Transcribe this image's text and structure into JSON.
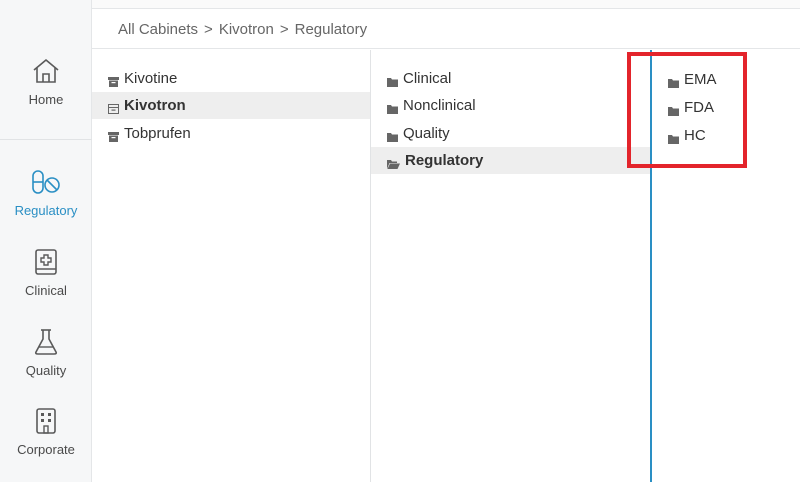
{
  "nav": {
    "items": [
      {
        "label": "Home",
        "icon": "home-icon"
      },
      {
        "label": "Regulatory",
        "icon": "capsule-pill-icon",
        "active": true
      },
      {
        "label": "Clinical",
        "icon": "medical-book-icon"
      },
      {
        "label": "Quality",
        "icon": "flask-icon"
      },
      {
        "label": "Corporate",
        "icon": "building-icon"
      }
    ],
    "accent_color": "#2a8fc4"
  },
  "breadcrumb": {
    "items": [
      "All Cabinets",
      "Kivotron",
      "Regulatory"
    ],
    "separator": ">"
  },
  "columns": {
    "cabinets": {
      "items": [
        {
          "label": "Kivotine",
          "icon": "cabinet-icon"
        },
        {
          "label": "Kivotron",
          "icon": "cabinet-open-icon",
          "selected": true
        },
        {
          "label": "Tobprufen",
          "icon": "cabinet-icon"
        }
      ]
    },
    "sections": {
      "items": [
        {
          "label": "Clinical",
          "icon": "folder-icon"
        },
        {
          "label": "Nonclinical",
          "icon": "folder-icon"
        },
        {
          "label": "Quality",
          "icon": "folder-icon"
        },
        {
          "label": "Regulatory",
          "icon": "folder-open-icon",
          "selected": true
        }
      ]
    },
    "subfolders": {
      "items": [
        {
          "label": "EMA",
          "icon": "folder-icon"
        },
        {
          "label": "FDA",
          "icon": "folder-icon"
        },
        {
          "label": "HC",
          "icon": "folder-icon"
        }
      ]
    }
  },
  "colors": {
    "highlight": "#e3242b",
    "column_accent": "#2a8fc4",
    "selected_row": "#eeeeee"
  }
}
